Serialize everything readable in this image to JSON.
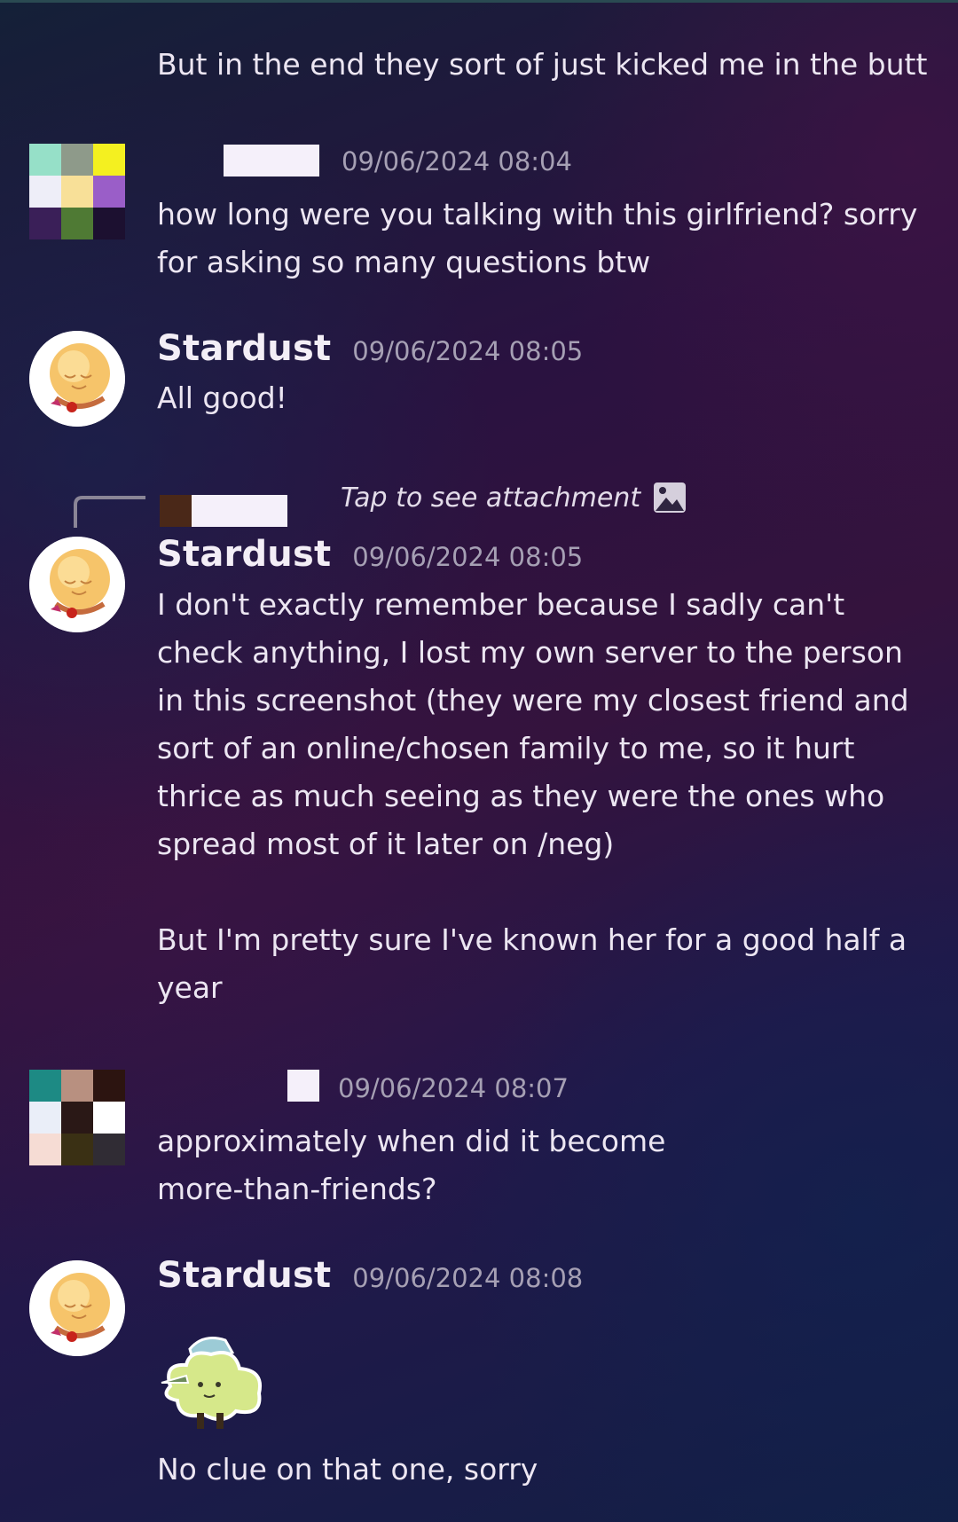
{
  "messages": [
    {
      "id": "m0",
      "text": "But in the end they sort of just kicked me in the butt"
    },
    {
      "id": "m1",
      "username": "",
      "timestamp": "09/06/2024 08:04",
      "text": "how long were you talking with this girlfriend? sorry for asking so many questions btw"
    },
    {
      "id": "m2",
      "username": "Stardust",
      "timestamp": "09/06/2024 08:05",
      "text": "All good!"
    },
    {
      "id": "m3",
      "reply_preview": "Tap to see attachment",
      "username": "Stardust",
      "timestamp": "09/06/2024 08:05",
      "text": "I don't exactly remember because I sadly can't check anything, I lost my own server to the person in this screenshot (they were my closest friend and sort of an online/chosen family to me, so it hurt thrice as much seeing as they were the ones who spread most of it later on /neg)\n\nBut I'm pretty sure I've known her for a good half a year"
    },
    {
      "id": "m4",
      "username": "",
      "timestamp": "09/06/2024 08:07",
      "text": "approximately when did it become more-than-friends?"
    },
    {
      "id": "m5",
      "username": "Stardust",
      "timestamp": "09/06/2024 08:08",
      "sticker": "dancing-tree-character-sticker",
      "text": "No clue on that one, sorry"
    }
  ],
  "icons": {
    "attachment": "image-icon",
    "reply": "reply-line-icon"
  },
  "colors": {
    "username": "#f3eef6",
    "timestamp": "#a6a0b4",
    "text": "#ece6f2"
  }
}
